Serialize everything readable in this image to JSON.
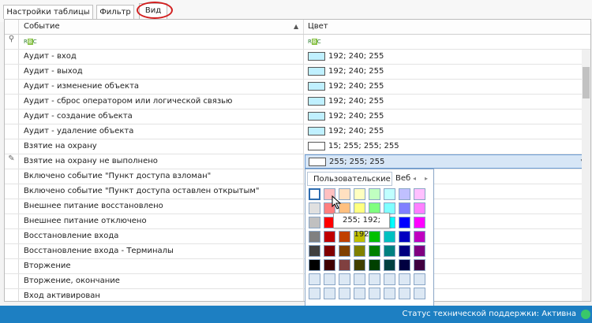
{
  "tabs": [
    {
      "label": "Настройки таблицы"
    },
    {
      "label": "Фильтр"
    },
    {
      "label": "Вид"
    }
  ],
  "grid": {
    "columns": [
      {
        "label": "Событие"
      },
      {
        "label": "Цвет"
      }
    ],
    "sort_icon": "sort-asc-icon",
    "filter_icon": "pin-icon",
    "filter_label": "RBC",
    "rows": [
      {
        "event": "Аудит - вход",
        "color": "192; 240; 255",
        "swatch": "#c0f0ff"
      },
      {
        "event": "Аудит - выход",
        "color": "192; 240; 255",
        "swatch": "#c0f0ff"
      },
      {
        "event": "Аудит - изменение объекта",
        "color": "192; 240; 255",
        "swatch": "#c0f0ff"
      },
      {
        "event": "Аудит - сброс оператором или логической связью",
        "color": "192; 240; 255",
        "swatch": "#c0f0ff"
      },
      {
        "event": "Аудит - создание объекта",
        "color": "192; 240; 255",
        "swatch": "#c0f0ff"
      },
      {
        "event": "Аудит - удаление объекта",
        "color": "192; 240; 255",
        "swatch": "#c0f0ff"
      },
      {
        "event": "Взятие на охрану",
        "color": "15; 255; 255; 255",
        "swatch": "#ffffff"
      },
      {
        "event": "Взятие на охрану не выполнено",
        "color": "255; 255; 255",
        "swatch": "#ffffff"
      },
      {
        "event": "Включено событие \"Пункт доступа взломан\"",
        "color": "",
        "swatch": ""
      },
      {
        "event": "Включено событие \"Пункт доступа оставлен открытым\"",
        "color": "",
        "swatch": ""
      },
      {
        "event": "Внешнее питание восстановлено",
        "color": "",
        "swatch": ""
      },
      {
        "event": "Внешнее питание отключено",
        "color": "",
        "swatch": ""
      },
      {
        "event": "Восстановление входа",
        "color": "",
        "swatch": ""
      },
      {
        "event": "Восстановление входа - Терминалы",
        "color": "",
        "swatch": ""
      },
      {
        "event": "Вторжение",
        "color": "",
        "swatch": ""
      },
      {
        "event": "Вторжение, окончание",
        "color": "",
        "swatch": ""
      },
      {
        "event": "Вход активирован",
        "color": "",
        "swatch": ""
      }
    ]
  },
  "color_popup": {
    "tabs": [
      {
        "label": "Пользовательские"
      },
      {
        "label": "Веб"
      }
    ],
    "nav_prev_icon": "arrow-left-icon",
    "nav_next_icon": "arrow-right-icon",
    "palette": [
      [
        "#ffffff",
        "#ffc0c0",
        "#ffe0c0",
        "#ffffc0",
        "#c0ffc0",
        "#c0ffff",
        "#c0c0ff",
        "#ffc0ff"
      ],
      [
        "#e0e0e0",
        "#ff8080",
        "#ffc080",
        "#ffff80",
        "#80ff80",
        "#80ffff",
        "#8080ff",
        "#ff80ff"
      ],
      [
        "#c0c0c0",
        "#ff0000",
        "#ff8000",
        "#ffff00",
        "#00ff00",
        "#00ffff",
        "#0000ff",
        "#ff00ff"
      ],
      [
        "#808080",
        "#c00000",
        "#c04000",
        "#c0c000",
        "#00c000",
        "#00c0c0",
        "#0000c0",
        "#c000c0"
      ],
      [
        "#404040",
        "#800000",
        "#804000",
        "#808000",
        "#008000",
        "#008080",
        "#000080",
        "#800080"
      ],
      [
        "#000000",
        "#400000",
        "#804040",
        "#404000",
        "#004000",
        "#004040",
        "#000040",
        "#400040"
      ],
      [
        "#dce8f4",
        "#dce8f4",
        "#dce8f4",
        "#dce8f4",
        "#dce8f4",
        "#dce8f4",
        "#dce8f4",
        "#dce8f4"
      ],
      [
        "#dce8f4",
        "#dce8f4",
        "#dce8f4",
        "#dce8f4",
        "#dce8f4",
        "#dce8f4",
        "#dce8f4",
        "#dce8f4"
      ]
    ],
    "tooltip": "255; 192; 192"
  },
  "statusbar": {
    "text": "Статус технической поддержки: Активна",
    "accent": "#1d7fc2"
  }
}
